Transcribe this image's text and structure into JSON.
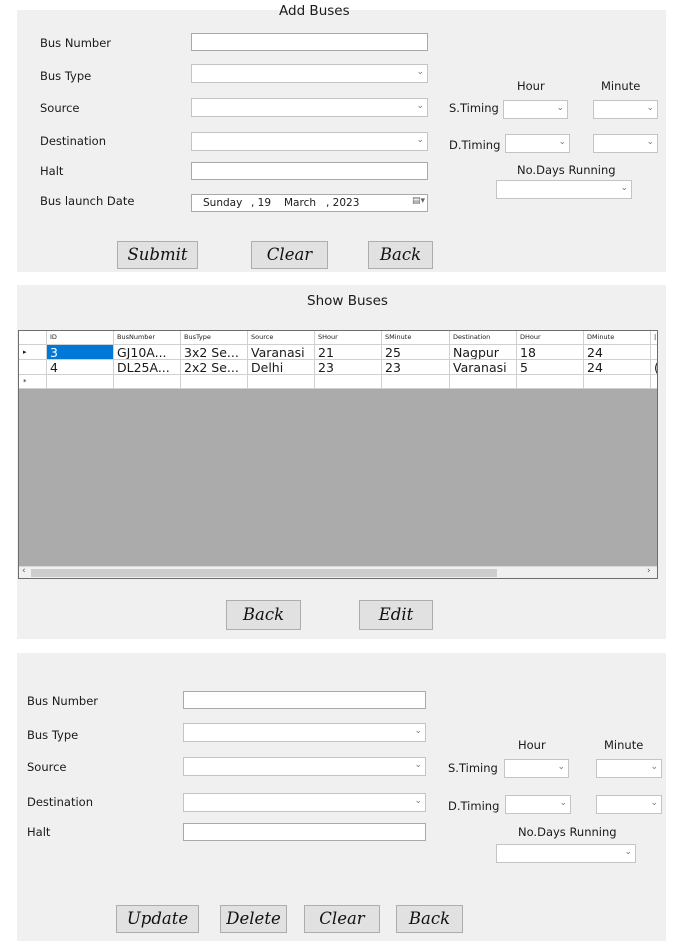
{
  "add_form": {
    "title": "Add Buses",
    "bus_number_label": "Bus Number",
    "bus_type_label": "Bus Type",
    "source_label": "Source",
    "destination_label": "Destination",
    "halt_label": "Halt",
    "launch_date_label": "Bus launch Date",
    "hour_label": "Hour",
    "minute_label": "Minute",
    "s_timing_label": "S.Timing",
    "d_timing_label": "D.Timing",
    "days_running_label": "No.Days Running",
    "date": {
      "day_name": "Sunday",
      "day": ", 19",
      "month": "March",
      "year": ", 2023"
    },
    "submit_label": "Submit",
    "clear_label": "Clear",
    "back_label": "Back"
  },
  "show_panel": {
    "title": "Show Buses",
    "columns": [
      "ID",
      "BusNumber",
      "BusType",
      "Source",
      "SHour",
      "SMinute",
      "Destination",
      "DHour",
      "DMinute"
    ],
    "rows": [
      [
        "3",
        "GJ10A...",
        "3x2 Se...",
        "Varanasi",
        "21",
        "25",
        "Nagpur",
        "18",
        "24"
      ],
      [
        "4",
        "DL25A...",
        "2x2 Se...",
        "Delhi",
        "23",
        "23",
        "Varanasi",
        "5",
        "24"
      ]
    ],
    "back_label": "Back",
    "edit_label": "Edit"
  },
  "edit_form": {
    "bus_number_label": "Bus Number",
    "bus_type_label": "Bus Type",
    "source_label": "Source",
    "destination_label": "Destination",
    "halt_label": "Halt",
    "hour_label": "Hour",
    "minute_label": "Minute",
    "s_timing_label": "S.Timing",
    "d_timing_label": "D.Timing",
    "days_running_label": "No.Days Running",
    "update_label": "Update",
    "delete_label": "Delete",
    "clear_label": "Clear",
    "back_label": "Back"
  },
  "colors": {
    "panel_bg": "#f0f0f0",
    "selection": "#0078d7",
    "grid_bg": "#ababab"
  }
}
